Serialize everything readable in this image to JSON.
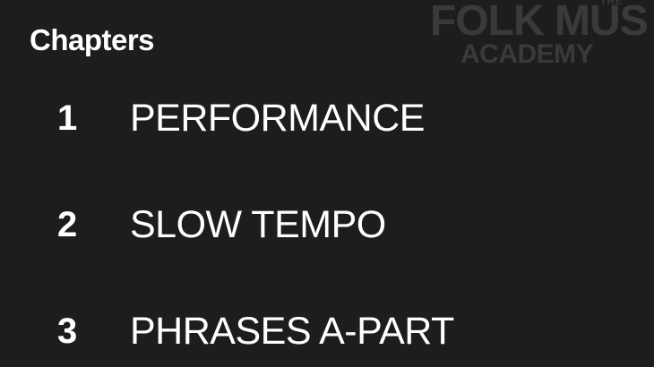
{
  "watermark": {
    "line0": "THE",
    "line1": "FOLK MUS",
    "line2": "ACADEMY"
  },
  "panel": {
    "title": "Chapters"
  },
  "chapters": [
    {
      "number": "1",
      "title": "PERFORMANCE"
    },
    {
      "number": "2",
      "title": "SLOW TEMPO"
    },
    {
      "number": "3",
      "title": "PHRASES A-PART"
    }
  ],
  "colors": {
    "background": "#1d1d1d",
    "text": "#ffffff",
    "watermark": "#3a3a3a"
  }
}
